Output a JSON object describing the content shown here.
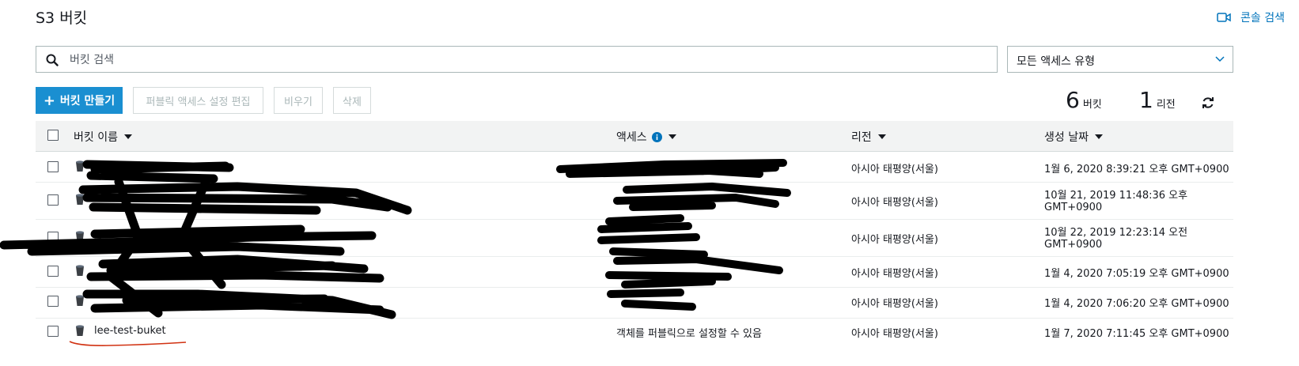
{
  "header": {
    "title": "S3 버킷",
    "console_search_label": "콘솔 검색"
  },
  "search": {
    "placeholder": "버킷 검색",
    "value": ""
  },
  "access_filter": {
    "selected": "모든 액세스 유형"
  },
  "toolbar": {
    "create_label": "버킷 만들기",
    "edit_public_label": "퍼블릭 액세스 설정 편집",
    "empty_label": "비우기",
    "delete_label": "삭제"
  },
  "stats": {
    "bucket_count": "6",
    "bucket_label": "버킷",
    "region_count": "1",
    "region_label": "리전"
  },
  "table": {
    "columns": {
      "name": "버킷 이름",
      "access": "액세스",
      "region": "리전",
      "created": "생성 날짜"
    },
    "rows": [
      {
        "name": "",
        "access": "",
        "region": "아시아 태평양(서울)",
        "created_1": "1월 6, 2020 8:39:21 오후 GMT+0900",
        "created_2": ""
      },
      {
        "name": "",
        "access": "",
        "region": "아시아 태평양(서울)",
        "created_1": "10월 21, 2019 11:48:36 오후",
        "created_2": "GMT+0900"
      },
      {
        "name": "",
        "access": "",
        "region": "아시아 태평양(서울)",
        "created_1": "10월 22, 2019 12:23:14 오전",
        "created_2": "GMT+0900"
      },
      {
        "name": "",
        "access": "",
        "region": "아시아 태평양(서울)",
        "created_1": "1월 4, 2020 7:05:19 오후 GMT+0900",
        "created_2": ""
      },
      {
        "name": "",
        "access": "",
        "region": "아시아 태평양(서울)",
        "created_1": "1월 4, 2020 7:06:20 오후 GMT+0900",
        "created_2": ""
      },
      {
        "name": "lee-test-buket",
        "access": "객체를 퍼블릭으로 설정할 수 있음",
        "region": "아시아 태평양(서울)",
        "created_1": "1월 7, 2020 7:11:45 오후 GMT+0900",
        "created_2": ""
      }
    ]
  },
  "colors": {
    "accent": "#1a8fd1",
    "link": "#0073bb",
    "header_bg": "#f2f3f3",
    "underline": "#d13212"
  }
}
